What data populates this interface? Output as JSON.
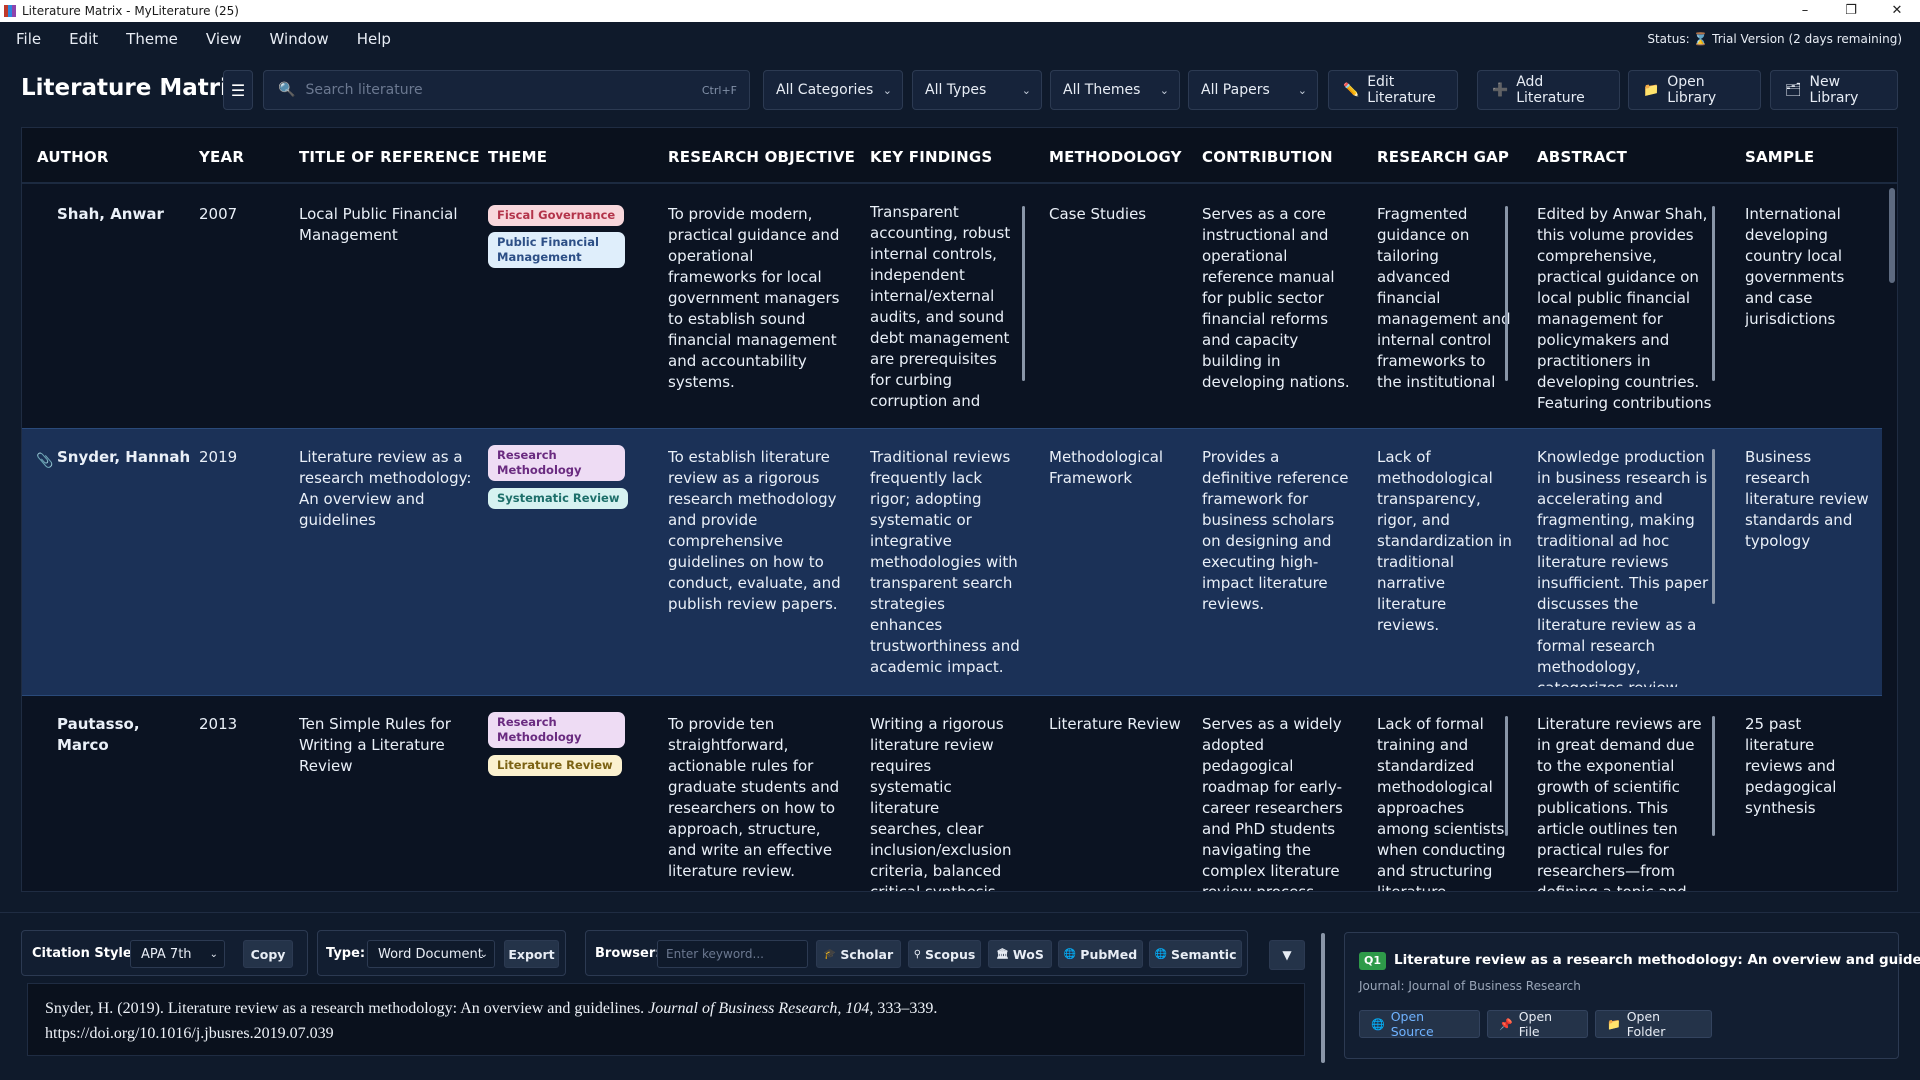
{
  "window": {
    "title": "Literature Matrix - MyLiterature (25)",
    "controls": [
      "–",
      "❐",
      "✕"
    ]
  },
  "menu": {
    "items": [
      "File",
      "Edit",
      "Theme",
      "View",
      "Window",
      "Help"
    ],
    "status": "Status: ⌛ Trial Version (2 days remaining)"
  },
  "toolbar": {
    "title": "Literature Matrix",
    "menu_glyph": "☰",
    "search_icon": "🔍",
    "search_placeholder": "Search literature",
    "search_shortcut": "Ctrl+F",
    "filters": [
      "All Categories",
      "All Types",
      "All Themes",
      "All Papers"
    ],
    "buttons": [
      {
        "label": "Edit Literature",
        "icon": "✏️"
      },
      {
        "label": "Add Literature",
        "icon": "➕"
      },
      {
        "label": "Open Library",
        "icon": "📁"
      },
      {
        "label": "New Library",
        "icon": "🗂"
      }
    ]
  },
  "table": {
    "columns": [
      "AUTHOR",
      "YEAR",
      "TITLE OF REFERENCE",
      "THEME",
      "RESEARCH OBJECTIVE",
      "KEY FINDINGS",
      "METHODOLOGY",
      "CONTRIBUTION",
      "RESEARCH GAP",
      "ABSTRACT",
      "SAMPLE"
    ],
    "rows": [
      {
        "author": "Shah, Anwar",
        "year": "2007",
        "title": "Local Public Financial Management",
        "themes": [
          "Fiscal Governance",
          "Public Financial Management"
        ],
        "objective": "To provide modern, practical guidance and operational frameworks for local government managers to establish sound financial management and accountability systems.",
        "findings": "Transparent accounting, robust internal controls, independent internal/external audits, and sound debt management are prerequisites for curbing corruption and",
        "methodology": "Case Studies",
        "contribution": "Serves as a core instructional and operational reference manual for public sector financial reforms and capacity building in developing nations.",
        "gap": "Fragmented guidance on tailoring advanced financial management and internal control frameworks to the institutional",
        "abstract": "Edited by Anwar Shah, this volume provides comprehensive, practical guidance on local public financial management for policymakers and practitioners in developing countries. Featuring contributions",
        "sample": "International developing country local governments and case jurisdictions"
      },
      {
        "author": "Snyder, Hannah",
        "year": "2019",
        "title": "Literature review as a research methodology: An overview and guidelines",
        "themes": [
          "Research Methodology",
          "Systematic Review"
        ],
        "objective": "To establish literature review as a rigorous research methodology and provide comprehensive guidelines on how to conduct, evaluate, and publish review papers.",
        "findings": "Traditional reviews frequently lack rigor; adopting systematic or integrative methodologies with transparent search strategies enhances trustworthiness and academic impact.",
        "methodology": "Methodological Framework",
        "contribution": "Provides a definitive reference framework for business scholars on designing and executing high-impact literature reviews.",
        "gap": "Lack of methodological transparency, rigor, and standardization in traditional narrative literature reviews.",
        "abstract": "Knowledge production in business research is accelerating and fragmenting, making traditional ad hoc literature reviews insufficient. This paper discusses the literature review as a formal research methodology, categorizes review",
        "sample": "Business research literature review standards and typology"
      },
      {
        "author": "Pautasso, Marco",
        "year": "2013",
        "title": "Ten Simple Rules for Writing a Literature Review",
        "themes": [
          "Research Methodology",
          "Literature Review"
        ],
        "objective": "To provide ten straightforward, actionable rules for graduate students and researchers on how to approach, structure, and write an effective literature review.",
        "findings": "Writing a rigorous literature review requires systematic literature searches, clear inclusion/exclusion criteria, balanced critical synthesis, and proper citation",
        "methodology": "Literature Review",
        "contribution": "Serves as a widely adopted pedagogical roadmap for early-career researchers and PhD students navigating the complex literature review process",
        "gap": "Lack of formal training and standardized methodological approaches among scientists when conducting and structuring literature",
        "abstract": "Literature reviews are in great demand due to the exponential growth of scientific publications. This article outlines ten practical rules for researchers—from defining a topic and audience to",
        "sample": "25 past literature reviews and pedagogical synthesis"
      }
    ]
  },
  "bottom": {
    "citation_style_label": "Citation Style:",
    "citation_style": "APA 7th",
    "copy": "Copy",
    "type_label": "Type:",
    "type_value": "Word Document",
    "export": "Export",
    "browser_label": "Browser:",
    "browser_placeholder": "Enter keyword...",
    "browsers": [
      {
        "label": "Scholar",
        "icon": "🎓"
      },
      {
        "label": "Scopus",
        "icon": "⚲"
      },
      {
        "label": "WoS",
        "icon": "🏛"
      },
      {
        "label": "PubMed",
        "icon": "🌐"
      },
      {
        "label": "Semantic",
        "icon": "🌐"
      }
    ],
    "collapse": "▼",
    "citation_text_before": "Snyder, H. (2019). Literature review as a research methodology: An overview and guidelines. ",
    "citation_journal": "Journal of Business Research",
    "citation_sep": ", ",
    "citation_volume": "104",
    "citation_pages": ", 333–339.",
    "citation_doi": "https://doi.org/10.1016/j.jbusres.2019.07.039"
  },
  "detail": {
    "quartile": "Q1",
    "title": "Literature review as a research methodology: An overview and guidelines",
    "journal": "Journal: Journal of Business Research",
    "buttons": [
      {
        "label": "Open Source",
        "icon": "🌐"
      },
      {
        "label": "Open File",
        "icon": "📌"
      },
      {
        "label": "Open Folder",
        "icon": "📁"
      }
    ]
  },
  "colors": {
    "background": "#0f1a2b",
    "selected_row": "#1b3157",
    "accent": "#5aa7ff"
  }
}
